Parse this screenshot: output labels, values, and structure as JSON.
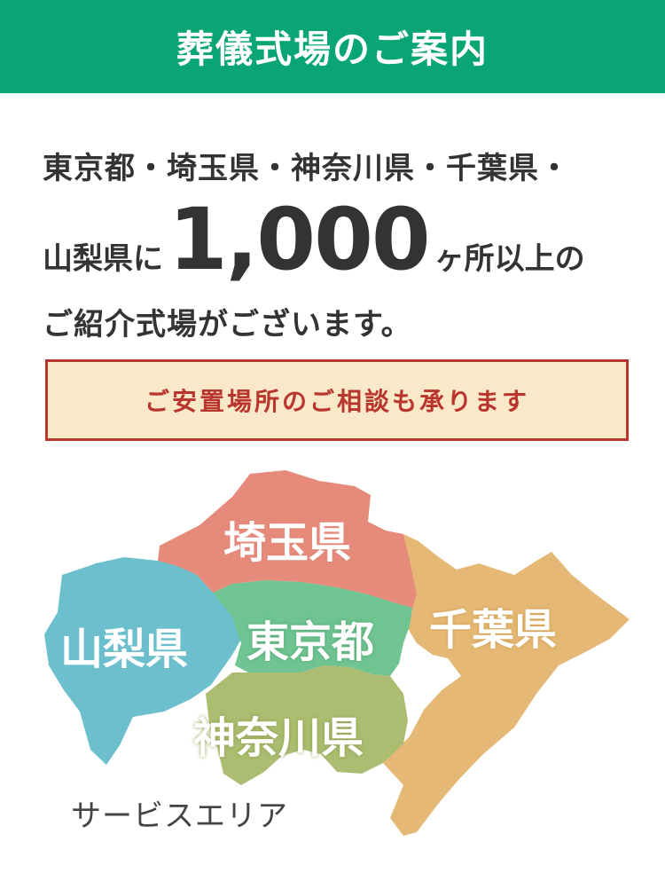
{
  "header": {
    "title": "葬儀式場のご案内"
  },
  "intro": {
    "line1": "東京都・埼玉県・神奈川県・千葉県・",
    "line2_prefix": "山梨県に",
    "line2_number": "1,000",
    "line2_suffix": "ヶ所以上の",
    "line3": "ご紹介式場がございます。"
  },
  "notice": {
    "text": "ご安置場所のご相談も承ります"
  },
  "map": {
    "regions": {
      "saitama": "埼玉県",
      "yamanashi": "山梨県",
      "tokyo": "東京都",
      "chiba": "千葉県",
      "kanagawa": "神奈川県"
    },
    "colors": {
      "saitama": "#e68a7b",
      "yamanashi": "#6cbfcc",
      "tokyo": "#6fc492",
      "chiba": "#e5b975",
      "kanagawa": "#acbc70"
    },
    "caption": "サービスエリア"
  },
  "colors": {
    "header_bg": "#0aa574",
    "notice_bg": "#f9e9c9",
    "notice_border": "#b8362d"
  }
}
